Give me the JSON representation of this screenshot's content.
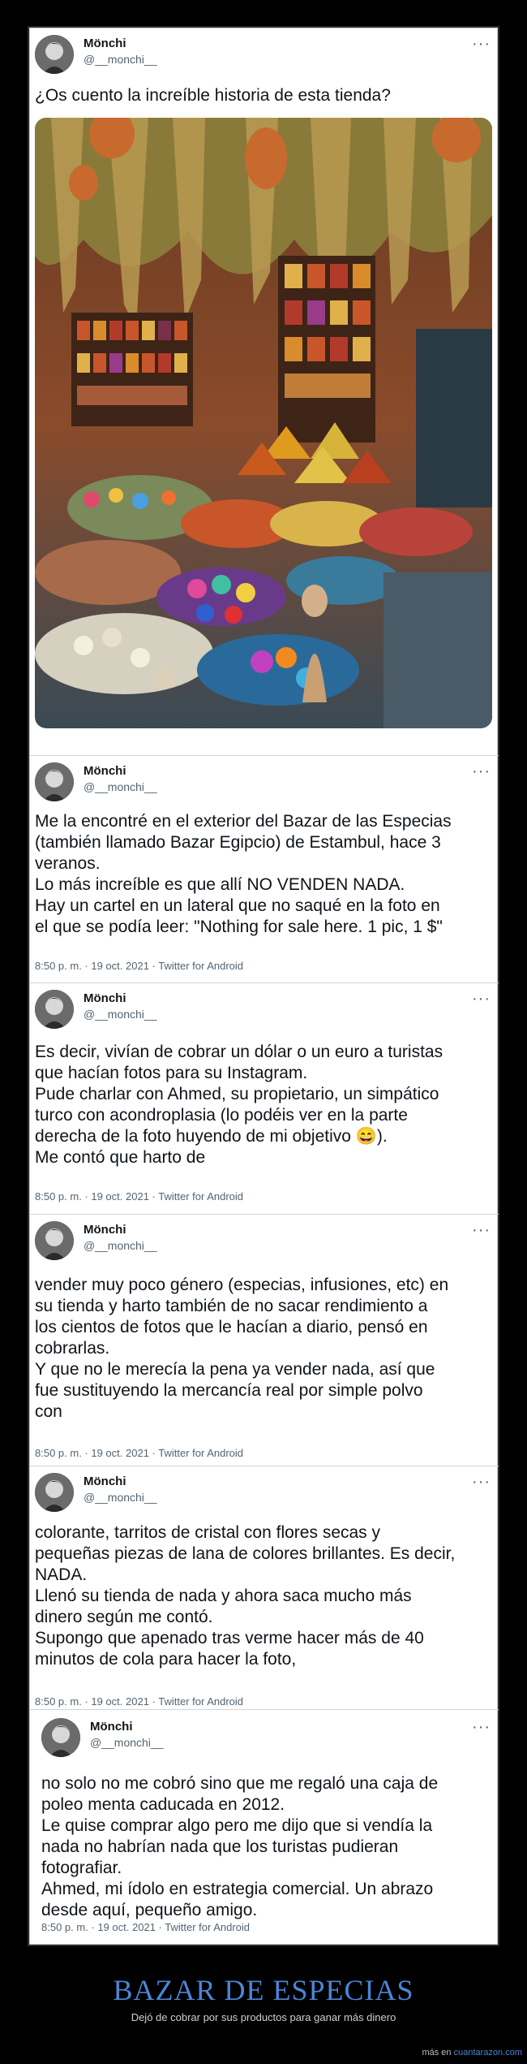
{
  "author": {
    "name": "Mönchi",
    "handle": "@__monchi__"
  },
  "more_label": "···",
  "tweets": [
    {
      "text": "¿Os cuento la increíble historia de esta tienda?",
      "meta": ""
    },
    {
      "text": "Me la encontré en el exterior del Bazar de las Especias\n(también llamado Bazar Egipcio) de Estambul, hace 3\nveranos.\nLo más increíble es que allí NO VENDEN NADA.\nHay un cartel en un lateral que no saqué en la foto en\nel que se podía leer: \"Nothing for sale here. 1 pic, 1 $\"",
      "meta": "8:50 p. m. · 19 oct. 2021 · Twitter for Android"
    },
    {
      "text": "Es decir, vivían de cobrar un dólar o un euro a turistas\nque hacían fotos para su Instagram.\nPude charlar con Ahmed, su propietario, un simpático\nturco con acondroplasia (lo podéis ver en la parte\nderecha de la foto huyendo de mi objetivo 😄).\nMe contó que harto de",
      "meta": "8:50 p. m. · 19 oct. 2021 · Twitter for Android"
    },
    {
      "text": "vender muy poco género (especias, infusiones, etc) en\nsu tienda y harto también de no sacar rendimiento a\nlos cientos de fotos que le hacían a diario, pensó en\ncobrarlas.\nY que no le merecía la pena ya vender nada, así que\nfue sustituyendo la mercancía real por simple polvo\ncon",
      "meta": "8:50 p. m. · 19 oct. 2021 · Twitter for Android"
    },
    {
      "text": "colorante, tarritos de cristal con flores secas y\npequeñas piezas de lana de colores brillantes. Es decir,\nNADA.\nLlenó su tienda de nada y ahora saca mucho más\ndinero según me contó.\nSupongo que apenado tras verme hacer más de 40\nminutos de cola para hacer la foto,",
      "meta": "8:50 p. m. · 19 oct. 2021 · Twitter for Android"
    },
    {
      "text": "no solo no me cobró sino que me regaló una caja de\npoleo menta caducada en 2012.\nLe quise comprar algo pero me dijo que si vendía la\nnada no habrían nada que los turistas pudieran\nfotografiar.\nAhmed, mi ídolo en estrategia comercial. Un abrazo\ndesde aquí, pequeño amigo.",
      "meta": "8:50 p. m. · 19 oct. 2021 · Twitter for Android"
    }
  ],
  "footer": {
    "title": "BAZAR DE ESPECIAS",
    "subtitle": "Dejó de cobrar por sus productos para ganar más dinero",
    "credit_prefix": "más en",
    "credit_site": "cuantarazon.com"
  },
  "colors": {
    "title_blue": "#4a86d8",
    "handle_gray": "#536471"
  }
}
